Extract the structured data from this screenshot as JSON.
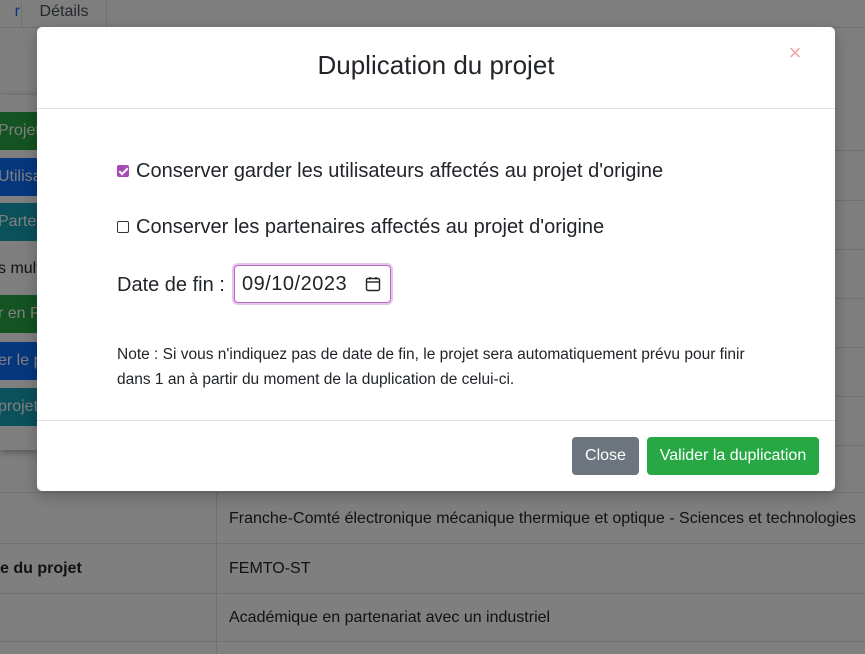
{
  "background": {
    "tabs": {
      "left_tab_fragment": "r",
      "details_tab": "Détails"
    },
    "side_buttons": [
      {
        "label": "Projet",
        "color": "#28a745"
      },
      {
        "label": "Utilisateurs",
        "color": "#0d6efd"
      },
      {
        "label": "Partenaires",
        "color": "#17a2b8"
      },
      {
        "label": "s multi",
        "color": "#ffffff"
      },
      {
        "label": "r en P",
        "color": "#28a745"
      },
      {
        "label": "er le p",
        "color": "#0d6efd"
      },
      {
        "label": "projet",
        "color": "#17a2b8"
      }
    ],
    "table": {
      "row1_value": "Franche-Comté électronique mécanique thermique et optique - Sciences et technologies",
      "row2_label": "e du projet",
      "row2_value": "FEMTO-ST",
      "row3_value": "Académique en partenariat avec un industriel"
    }
  },
  "modal": {
    "title": "Duplication du projet",
    "close_icon": "×",
    "options": [
      {
        "label": "Conserver garder les utilisateurs affectés au projet d'origine",
        "checked": true
      },
      {
        "label": "Conserver les partenaires affectés au projet d'origine",
        "checked": false
      }
    ],
    "date_label": "Date de fin :",
    "date_value": "09/10/2023",
    "note": "Note : Si vous n'indiquez pas de date de fin, le projet sera automatiquement prévu pour finir dans 1 an à partir du moment de la duplication de celui-ci.",
    "buttons": {
      "close": "Close",
      "validate": "Valider la duplication"
    },
    "accent_color": "#a64db4"
  }
}
